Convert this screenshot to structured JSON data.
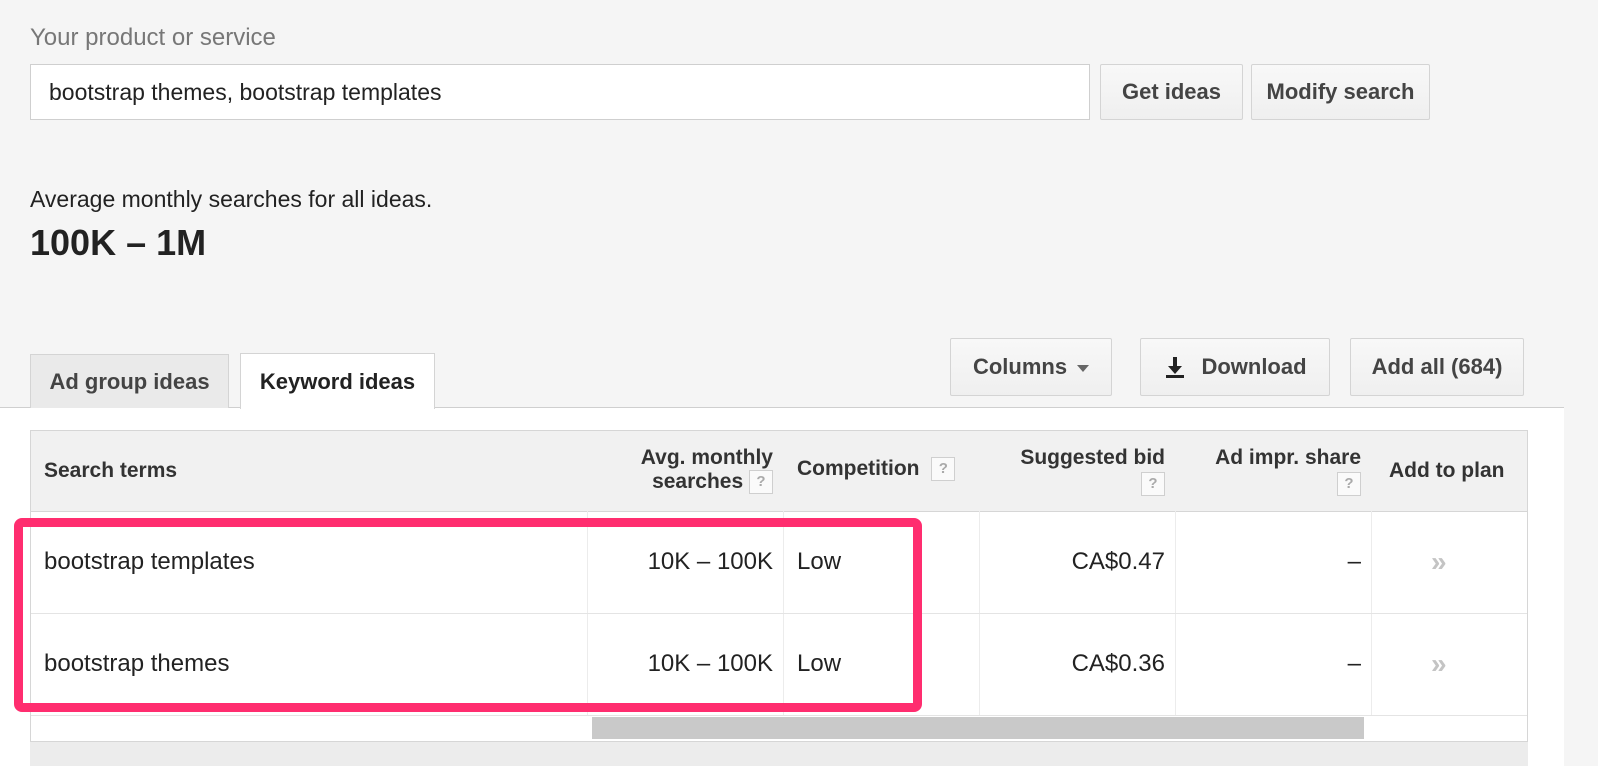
{
  "search": {
    "label": "Your product or service",
    "value": "bootstrap themes, bootstrap templates"
  },
  "buttons": {
    "get_ideas": "Get ideas",
    "modify_search": "Modify search",
    "columns": "Columns",
    "download": "Download",
    "add_all": "Add all (684)"
  },
  "summary": {
    "label": "Average monthly searches for all ideas.",
    "value": "100K – 1M"
  },
  "tabs": [
    {
      "label": "Ad group ideas",
      "active": false
    },
    {
      "label": "Keyword ideas",
      "active": true
    }
  ],
  "table": {
    "headers": {
      "search_terms": "Search terms",
      "avg_line1": "Avg. monthly",
      "avg_line2": "searches",
      "competition": "Competition",
      "suggested_bid": "Suggested bid",
      "ad_impr_share": "Ad impr. share",
      "add_to_plan": "Add to plan",
      "help": "?"
    },
    "rows": [
      {
        "term": "bootstrap templates",
        "searches": "10K – 100K",
        "competition": "Low",
        "bid": "CA$0.47",
        "impr": "–",
        "add": "»"
      },
      {
        "term": "bootstrap themes",
        "searches": "10K – 100K",
        "competition": "Low",
        "bid": "CA$0.36",
        "impr": "–",
        "add": "»"
      }
    ]
  },
  "colors": {
    "highlight": "#ff2d6f",
    "background": "#f5f5f5",
    "header_bg": "#f1f1f1"
  },
  "icons": {
    "download": "download-icon",
    "columns_caret": "caret-down-icon",
    "add_to_plan": "double-chevron-right-icon",
    "help": "help-icon"
  }
}
